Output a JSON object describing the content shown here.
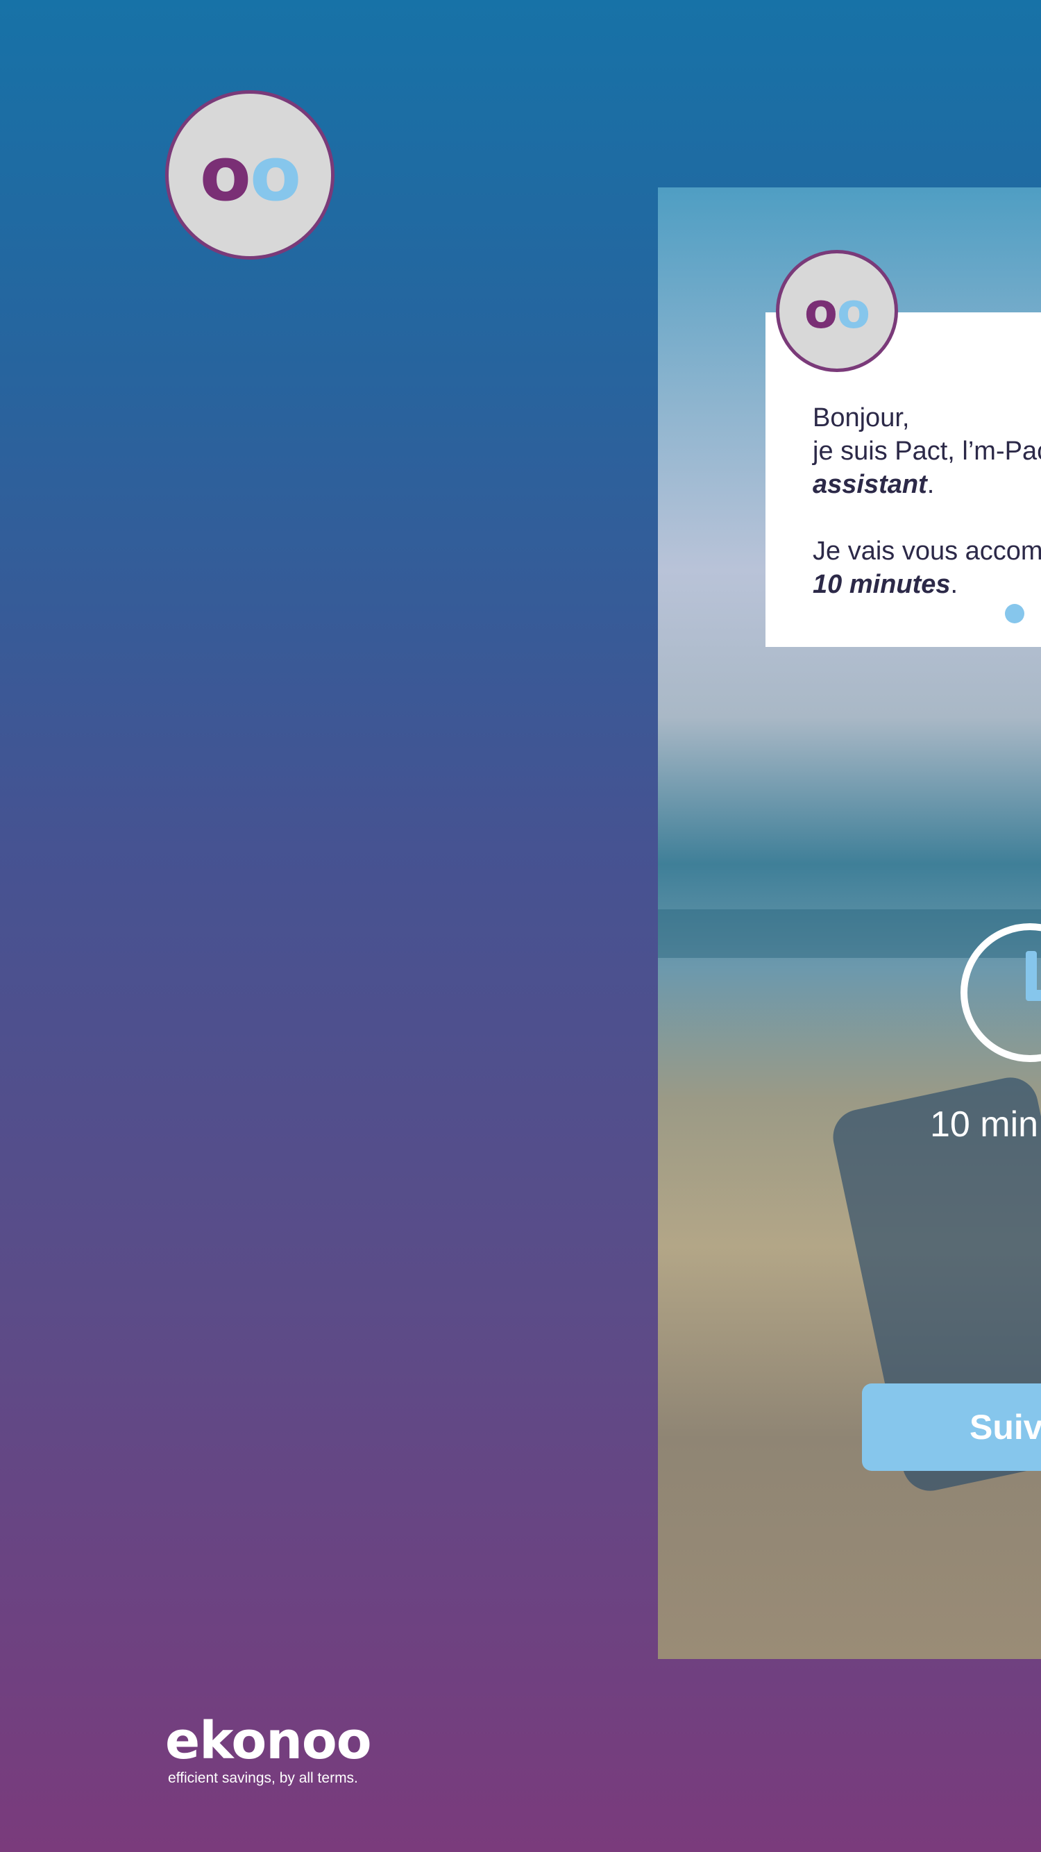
{
  "logo": {
    "o1": "o",
    "o2": "o"
  },
  "card": {
    "line1": "Bonjour,",
    "line2_prefix": "je suis Pact, l’m-Pac",
    "line3_bold": "assistant",
    "line3_suffix": ".",
    "line4": "Je vais vous accom",
    "line5_bold": "10 minutes",
    "line5_suffix": "."
  },
  "duration": {
    "label": "10 min"
  },
  "button": {
    "label": "Suiv"
  },
  "brand": {
    "name": "ekonoo",
    "tagline": "efficient savings, by all terms."
  },
  "colors": {
    "purple": "#7a2f75",
    "light_blue": "#86c6ec",
    "white": "#ffffff"
  }
}
